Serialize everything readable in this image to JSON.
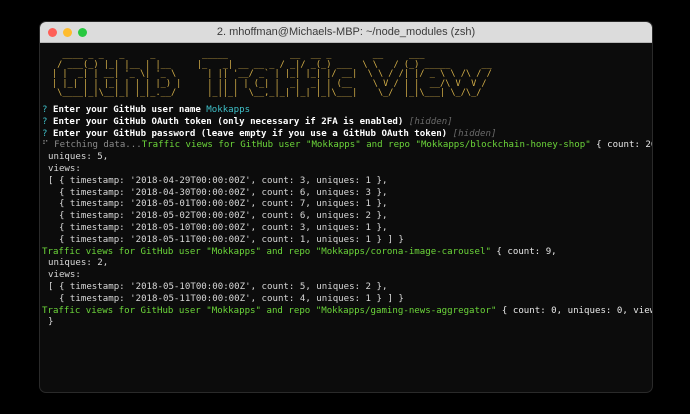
{
  "window": {
    "title": "2. mhoffman@Michaels-MBP: ~/node_modules (zsh)"
  },
  "banner": {
    "lines": [
      "  ____ _ _   _     _         _____            __  __ _        __     ___",
      " / ___(_) |_| |__ | |__     |_   _| __ __ _ / _|/ _(_) ___  \\ \\   / (_) _____      __",
      "| |  _| | __| '_ \\| '_ \\      | || '__/ _` | |_| |_| |/ __|  \\ \\ / /| |/ _ \\ \\ /\\ / /",
      "| |_| | | |_| | | | |_) |     | || | | (_| |  _|  _| | (__    \\ V / | |  __/\\ V  V /",
      " \\____|_|\\__|_| |_|_.__/      |_||_|  \\__,_|_| |_| |_|\\___|    \\_/  |_|\\___| \\_/\\_/"
    ]
  },
  "prompts": {
    "q_mark": "?",
    "user_label": "Enter your GitHub user name",
    "user_value": "Mokkapps",
    "token_label": "Enter your GitHub OAuth token (only necessary if 2FA is enabled)",
    "token_hint": "[hidden]",
    "password_label": "Enter your GitHub password (leave empty if you use a GitHub OAuth token)",
    "password_hint": "[hidden]"
  },
  "output": {
    "fetching": "⠋ Fetching data...",
    "repo1": {
      "header": "Traffic views for GitHub user \"Mokkapps\" and repo \"Mokkapps/blockchain-honey-shop\"",
      "tail": " { count: 26,",
      "uniques": "uniques: 5,",
      "views_label": "views:",
      "rows": [
        "[ { timestamp: '2018-04-29T00:00:00Z', count: 3, uniques: 1 },",
        "  { timestamp: '2018-04-30T00:00:00Z', count: 6, uniques: 3 },",
        "  { timestamp: '2018-05-01T00:00:00Z', count: 7, uniques: 1 },",
        "  { timestamp: '2018-05-02T00:00:00Z', count: 6, uniques: 2 },",
        "  { timestamp: '2018-05-10T00:00:00Z', count: 3, uniques: 1 },",
        "  { timestamp: '2018-05-11T00:00:00Z', count: 1, uniques: 1 } ] }"
      ]
    },
    "repo2": {
      "header": "Traffic views for GitHub user \"Mokkapps\" and repo \"Mokkapps/corona-image-carousel\"",
      "tail": " { count: 9,",
      "uniques": "uniques: 2,",
      "views_label": "views:",
      "rows": [
        "[ { timestamp: '2018-05-10T00:00:00Z', count: 5, uniques: 2 },",
        "  { timestamp: '2018-05-11T00:00:00Z', count: 4, uniques: 1 } ] }"
      ]
    },
    "repo3": {
      "header": "Traffic views for GitHub user \"Mokkapps\" and repo \"Mokkapps/gaming-news-aggregator\"",
      "tail": " { count: 0, uniques: 0, views: []"
    },
    "closing": "}"
  }
}
